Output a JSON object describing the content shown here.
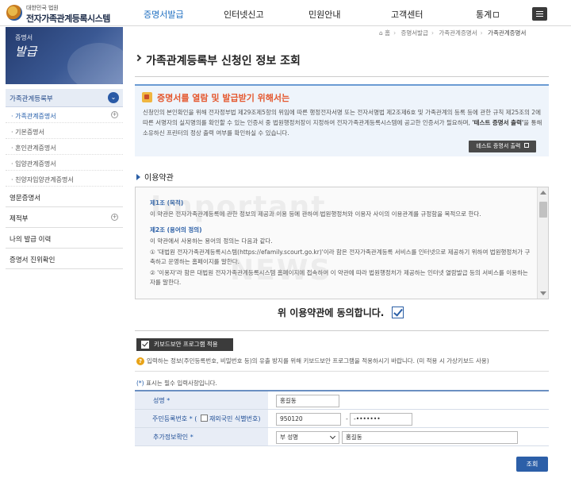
{
  "header": {
    "logo_small": "대한민국 법원",
    "logo_big": "전자가족관계등록시스템",
    "gnb": [
      "증명서발급",
      "인터넷신고",
      "민원안내",
      "고객센터",
      "통계"
    ]
  },
  "sidebar": {
    "banner_line1": "증명서",
    "banner_line2": "발급",
    "section_title": "가족관계등록부",
    "sub_items": [
      "가족관계증명서",
      "기본증명서",
      "혼인관계증명서",
      "입양관계증명서",
      "친양자입양관계증명서"
    ],
    "main_items": [
      "영문증명서",
      "제적부",
      "나의 발급 이력",
      "증명서 진위확인"
    ]
  },
  "breadcrumb": [
    "홈",
    "증명서발급",
    "가족관계증명서",
    "가족관계증명서"
  ],
  "page_title": "가족관계등록부 신청인 정보 조회",
  "notice": {
    "heading": "증명서를 열람 및 발급받기 위해서는",
    "body_pre": "신청인의 본인확인을 위해 전자정부법 제29조제5항의 위임에 따른 행정전자서명 또는 전자서명법 제2조제6호 및 가족관계의 등록 등에 관한 규칙 제25조의 2에 따른 서명자의 실지명의를 확인할 수 있는 인증서 중 법원행정처장이 지정하여 전자가족관계등록시스템에 공고한 인증서가 필요하며, ",
    "body_bold": "'테스트 증명서 출력'",
    "body_post": "을 통해 소유하신 프린터의 정상 출력 여부를 확인하실 수 있습니다.",
    "test_button": "테스트 증명서 출력"
  },
  "terms": {
    "title": "이용약관",
    "art1_title": "제1조 (목적)",
    "art1_body": "이 약관은 전자가족관계등록에 관한 정보의 제공과 이용 등에 관하여 법원행정처와 이용자 사이의 이용관계를 규정함을 목적으로 한다.",
    "art2_title": "제2조 (용어의 정의)",
    "art2_intro": "이 약관에서 사용하는 용어의 정의는 다음과 같다.",
    "art2_item1": "① '대법원 전자가족관계등록시스템(https://efamily.scourt.go.kr)'이라 함은 전자가족관계등록 서비스를 인터넷으로 제공하기 위하여 법원행정처가 구축하고 운영하는 홈페이지를 말한다.",
    "art2_item2": "② '이용자'라 함은 대법원 전자가족관계등록시스템 홈페이지에 접속하여 이 약관에 따라 법원행정처가 제공하는 인터넷 열람발급 등의 서비스를 이용하는 자를 말한다.",
    "watermark1": "Important",
    "watermark2": "NEWS"
  },
  "agree_text": "위 이용약관에 동의합니다.",
  "keyboard": {
    "button": "키보드보안 프로그램 적용",
    "note": "입력하는 정보(주민등록번호, 비밀번호 등)의 유출 방지를 위해 키보드보안 프로그램을 적용하시기 바랍니다. (미 적용 시 가상키보드 사용)"
  },
  "required_note_ast": "(*)",
  "required_note": " 표시는 필수 입력사항입니다.",
  "form": {
    "name_label": "성명",
    "name_value": "홍길동",
    "rrn_label": "주민등록번호",
    "foreign_label": "재외국민 식별번호",
    "rrn_front": "950120",
    "rrn_back": "-•••••••",
    "extra_label": "추가정보확인",
    "extra_select": "부 성명",
    "extra_value": "홍길동"
  },
  "search_button": "조회"
}
